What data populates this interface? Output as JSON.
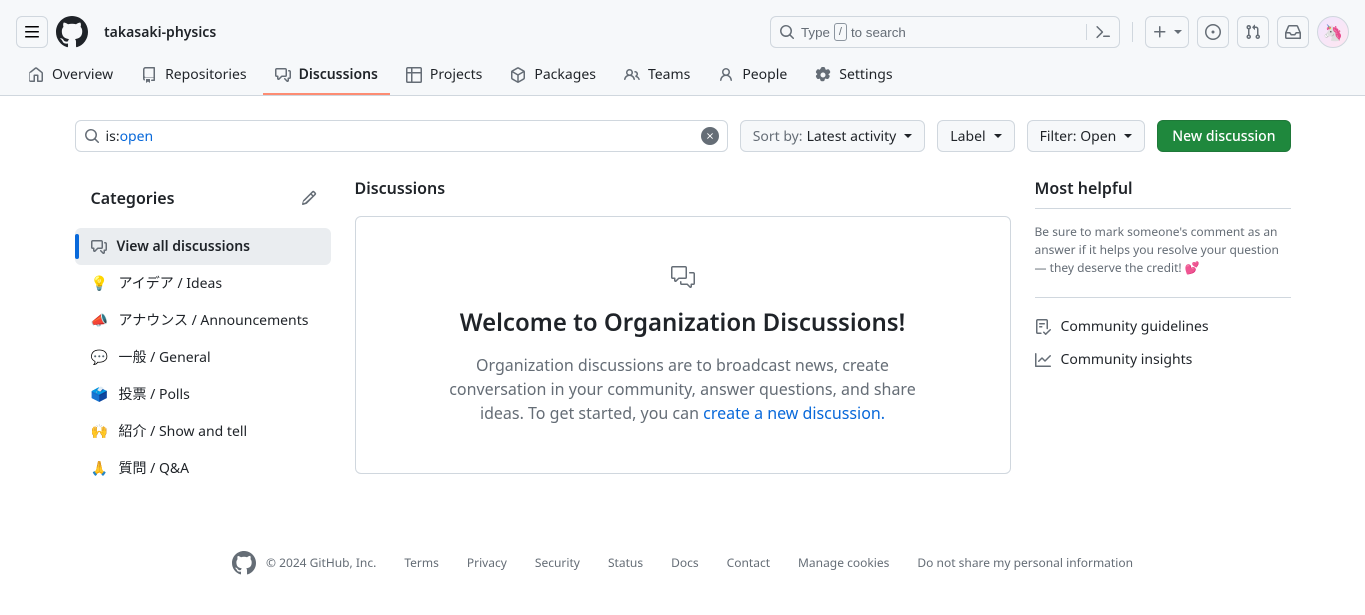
{
  "header": {
    "org_name": "takasaki-physics",
    "search_placeholder_a": "Type",
    "search_key": "/",
    "search_placeholder_b": "to search"
  },
  "nav": {
    "overview": "Overview",
    "repositories": "Repositories",
    "discussions": "Discussions",
    "projects": "Projects",
    "packages": "Packages",
    "teams": "Teams",
    "people": "People",
    "settings": "Settings"
  },
  "filter": {
    "search_prefix": "is:",
    "search_value": "open",
    "sort_prefix": "Sort by: ",
    "sort_value": "Latest activity",
    "label_btn": "Label",
    "filter_btn": "Filter: Open",
    "new_discussion": "New discussion"
  },
  "categories": {
    "title": "Categories",
    "items": [
      {
        "icon_type": "svg",
        "label": "View all discussions",
        "selected": true
      },
      {
        "emoji": "💡",
        "label": "アイデア / Ideas"
      },
      {
        "emoji": "📣",
        "label": "アナウンス / Announcements"
      },
      {
        "emoji": "💬",
        "label": "一般 / General"
      },
      {
        "emoji": "🗳️",
        "label": "投票 / Polls"
      },
      {
        "emoji": "🙌",
        "label": "紹介 / Show and tell"
      },
      {
        "emoji": "🙏",
        "label": "質問 / Q&A"
      }
    ]
  },
  "main": {
    "title": "Discussions",
    "blankslate_title": "Welcome to Organization Discussions!",
    "blankslate_desc_a": "Organization discussions are to broadcast news, create conversation in your community, answer questions, and share ideas. To get started, you can ",
    "blankslate_link": "create a new discussion."
  },
  "right": {
    "title": "Most helpful",
    "helpful_text": "Be sure to mark someone's comment as an answer if it helps you resolve your question — they deserve the credit! 💕",
    "guidelines": "Community guidelines",
    "insights": "Community insights"
  },
  "footer": {
    "copyright": "© 2024 GitHub, Inc.",
    "links": [
      "Terms",
      "Privacy",
      "Security",
      "Status",
      "Docs",
      "Contact",
      "Manage cookies",
      "Do not share my personal information"
    ]
  }
}
